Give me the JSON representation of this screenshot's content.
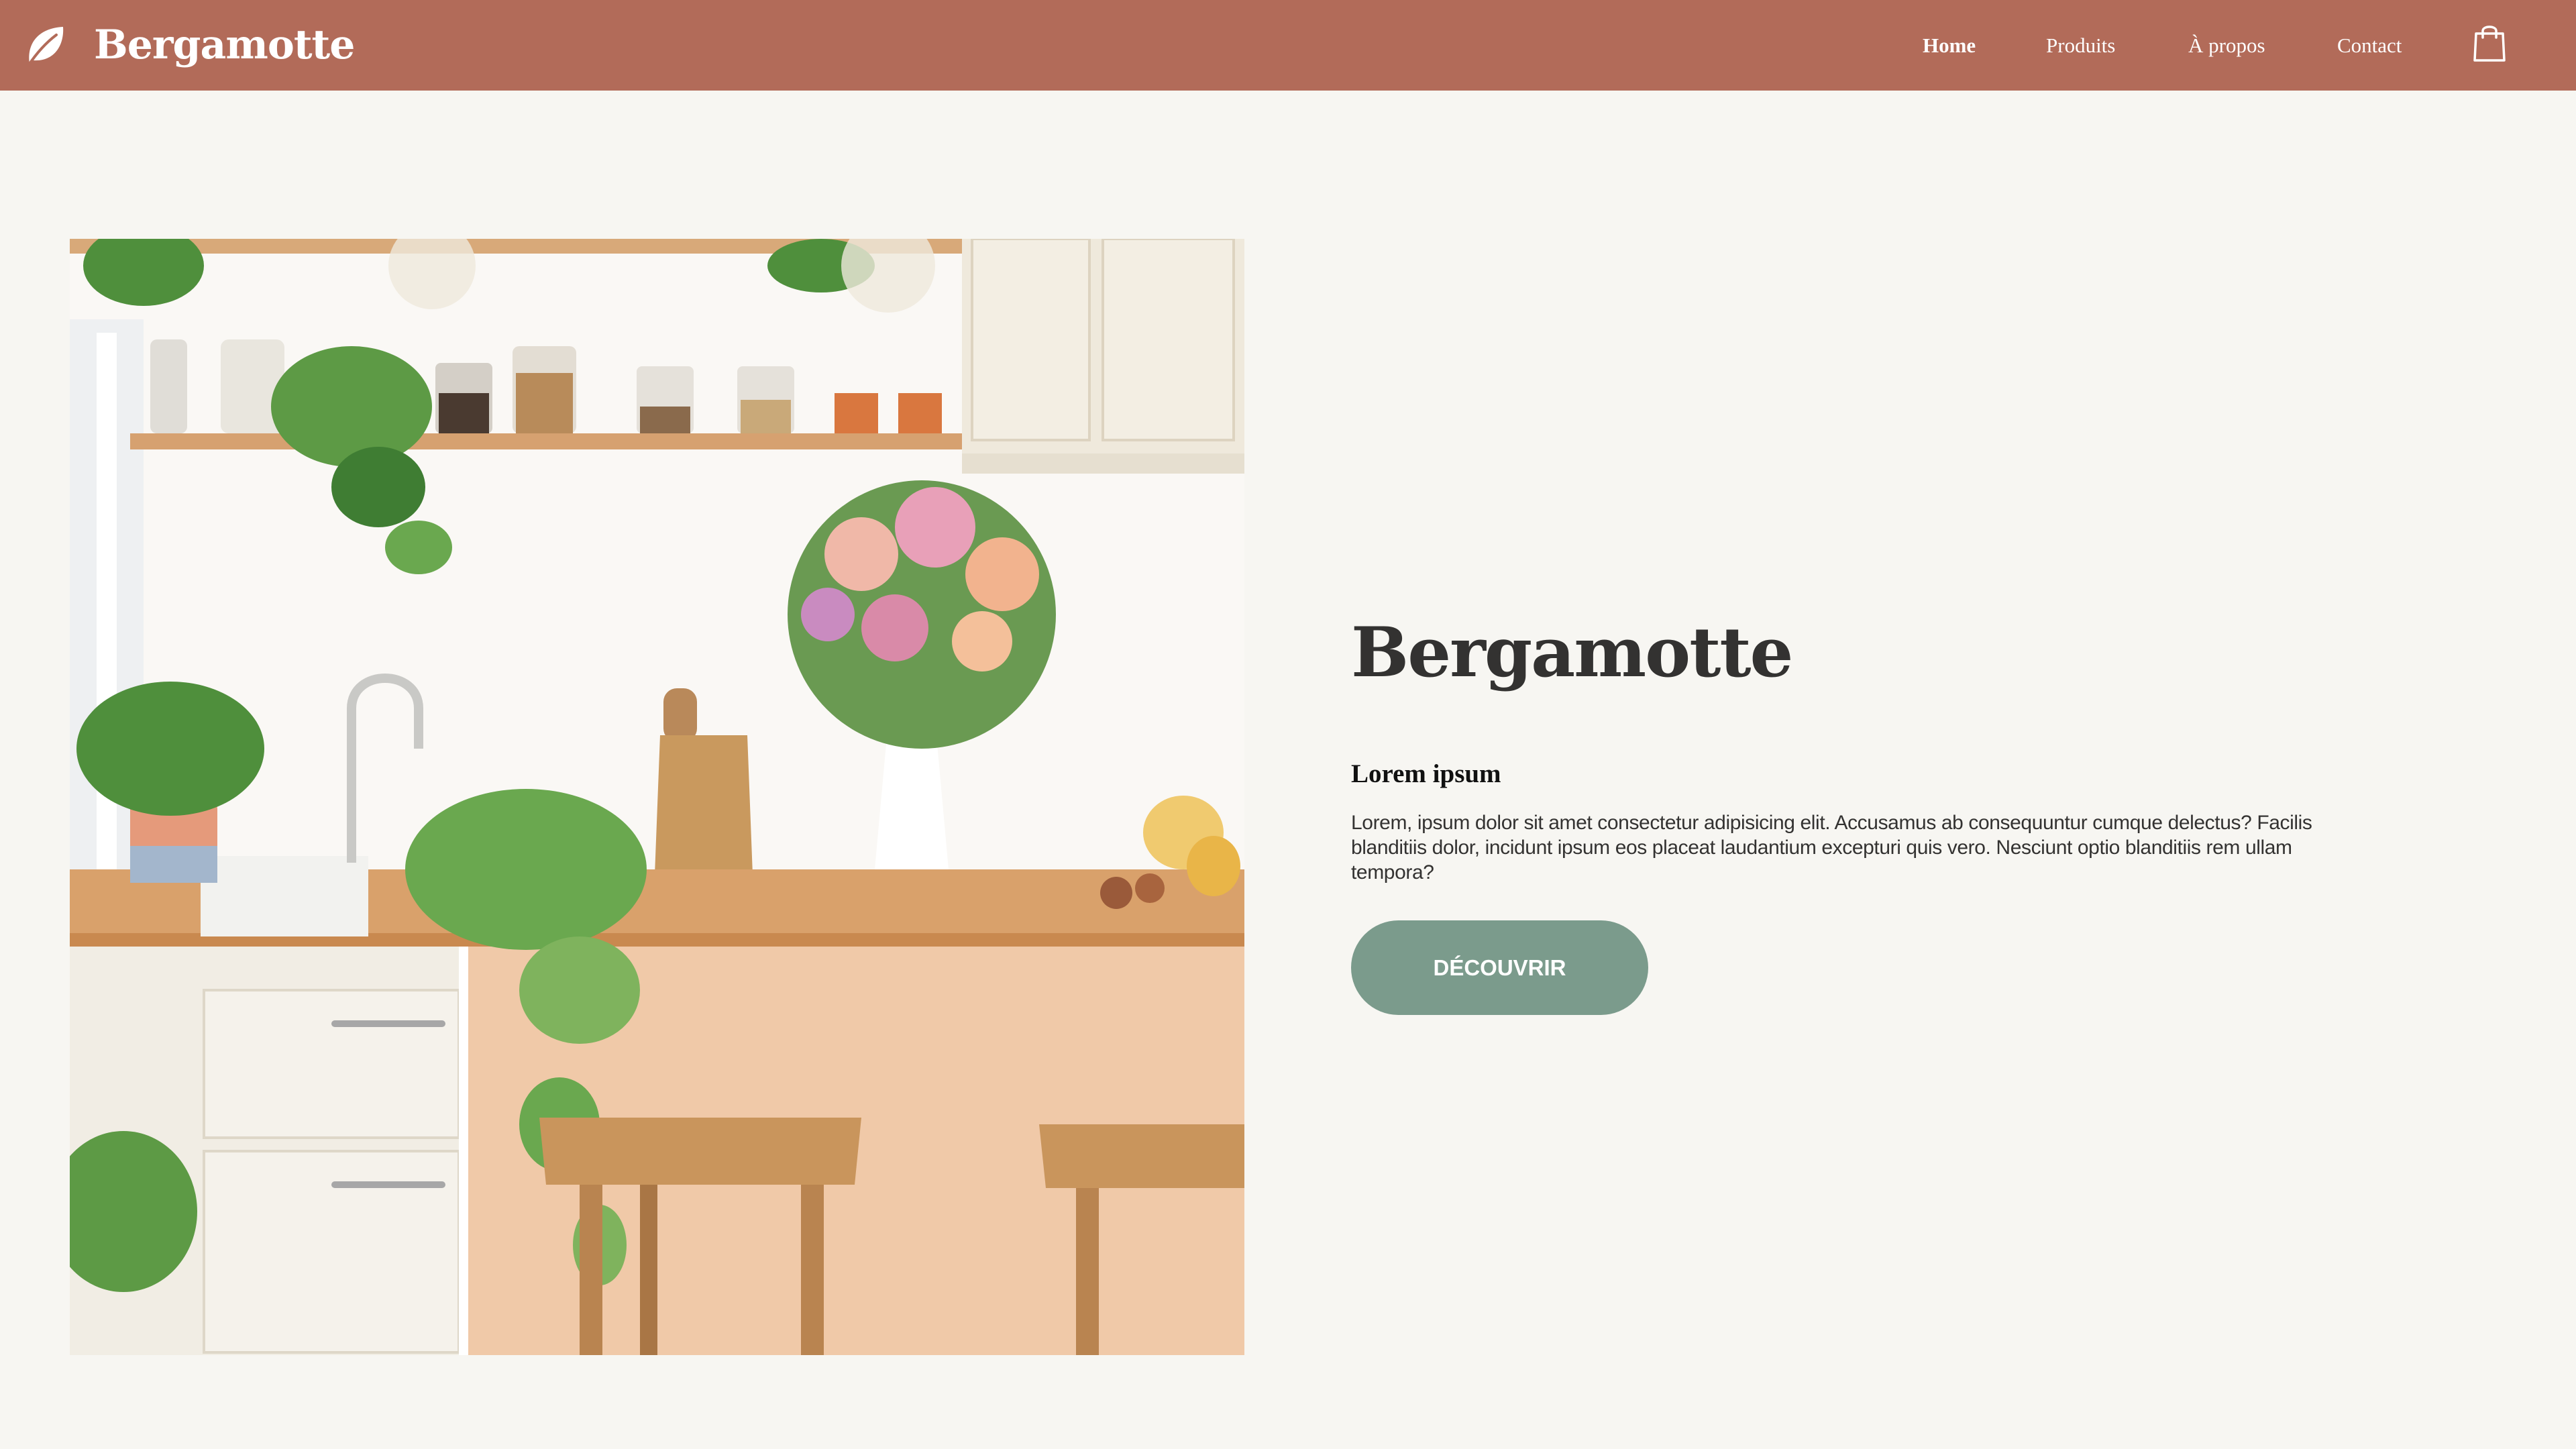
{
  "header": {
    "brand": "Bergamotte",
    "logo_icon": "leaf-icon",
    "nav": [
      {
        "label": "Home",
        "active": true
      },
      {
        "label": "Produits",
        "active": false
      },
      {
        "label": "À propos",
        "active": false
      },
      {
        "label": "Contact",
        "active": false
      }
    ],
    "cart_icon": "shopping-bag-icon"
  },
  "hero": {
    "title": "Bergamotte",
    "subtitle": "Lorem ipsum",
    "description": "Lorem, ipsum dolor sit amet consectetur adipisicing elit. Accusamus ab consequuntur cumque delectus? Facilis blanditiis dolor, incidunt ipsum eos placeat laudantium excepturi quis vero. Nesciunt optio blanditiis rem ullam tempora?",
    "cta_label": "DÉCOUVRIR"
  },
  "colors": {
    "header_bg": "#b26b59",
    "page_bg": "#f7f6f2",
    "accent_button": "#7b9b8c",
    "title_text": "#333231"
  }
}
